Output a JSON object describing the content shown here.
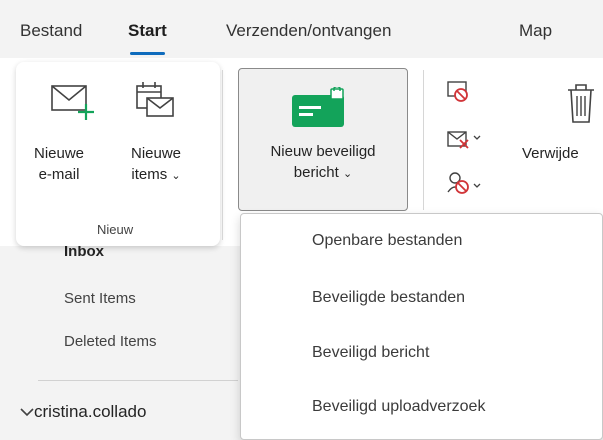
{
  "menu": {
    "tabs": [
      {
        "label": "Bestand"
      },
      {
        "label": "Start"
      },
      {
        "label": "Verzenden/ontvangen"
      },
      {
        "label": "Map"
      }
    ]
  },
  "ribbon": {
    "new_mail": {
      "line1": "Nieuwe",
      "line2": "e-mail"
    },
    "new_items": {
      "line1": "Nieuwe",
      "line2": "items"
    },
    "group_new_label": "Nieuw",
    "secure_message": {
      "line1": "Nieuw beveiligd",
      "line2": "bericht"
    },
    "delete_label": "Verwijde",
    "colors": {
      "accent": "#0f6cbd",
      "secure_icon": "#13a35a",
      "delete_red": "#d13438"
    }
  },
  "folders": {
    "inbox": "Inbox",
    "sent": "Sent Items",
    "deleted": "Deleted Items",
    "account": "cristina.collado"
  },
  "dropdown": {
    "items": [
      {
        "label": "Openbare bestanden"
      },
      {
        "label": "Beveiligde bestanden"
      },
      {
        "label": "Beveiligd bericht"
      },
      {
        "label": "Beveiligd uploadverzoek"
      }
    ]
  }
}
